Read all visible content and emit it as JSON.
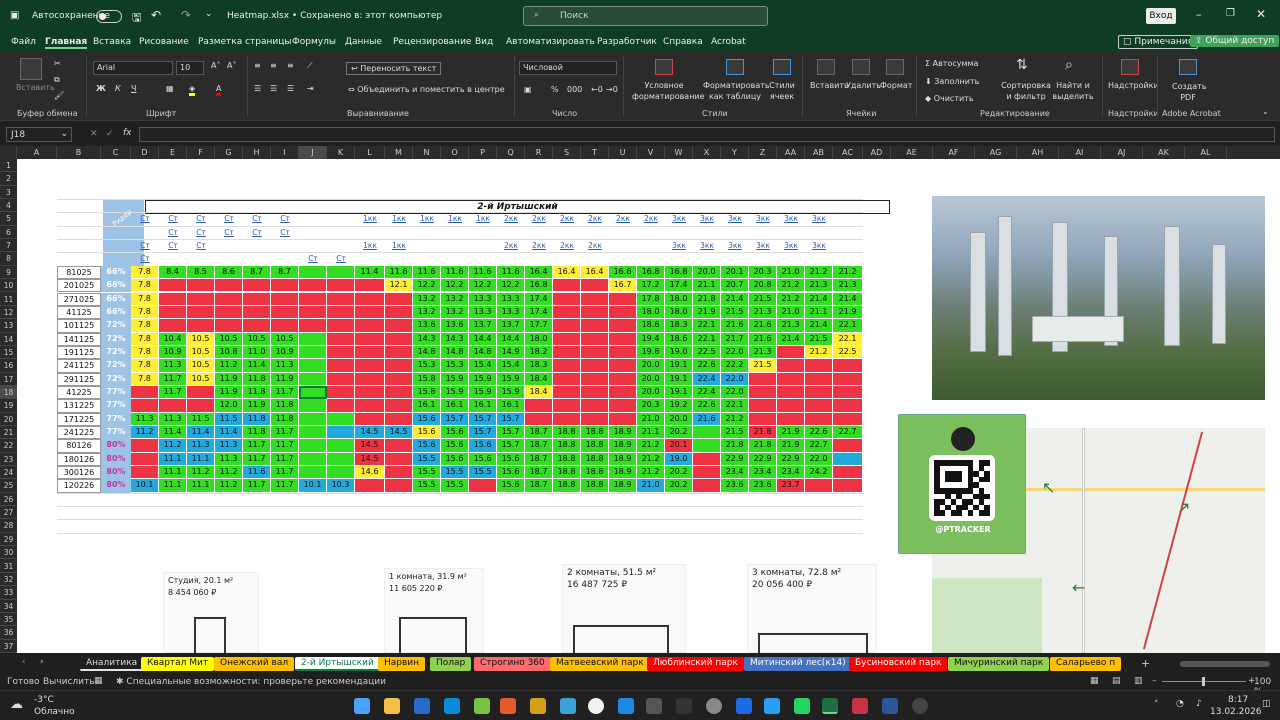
{
  "titlebar": {
    "autosave": "Автосохранение",
    "filename": "Heatmap.xlsx • Сохранено в: этот компьютер",
    "search": "Поиск",
    "signin": "Вход"
  },
  "menu": [
    "Файл",
    "Главная",
    "Вставка",
    "Рисование",
    "Разметка страницы",
    "Формулы",
    "Данные",
    "Рецензирование",
    "Вид",
    "Автоматизировать",
    "Разработчик",
    "Справка",
    "Acrobat"
  ],
  "comments": "Примечания",
  "share": "Общий доступ",
  "ribbon": {
    "paste": "Вставить",
    "clipboard": "Буфер обмена",
    "font_name": "Arial",
    "font_size": "10",
    "font": "Шрифт",
    "wrap": "Переносить текст",
    "merge": "Объединить и поместить в центре",
    "align": "Выравнивание",
    "numfmt": "Числовой",
    "number": "Число",
    "cond": "Условное форматирование",
    "astable": "Форматировать как таблицу",
    "styles_btn": "Стили ячеек",
    "styles": "Стили",
    "insert": "Вставить",
    "delete": "Удалить",
    "format": "Формат",
    "cells": "Ячейки",
    "autosum": "Автосумма",
    "fill": "Заполнить",
    "clear": "Очистить",
    "sort": "Сортировка и фильтр",
    "find": "Найти и выделить",
    "editing": "Редактирование",
    "addins_btn": "Надстройки",
    "addins": "Надстройки",
    "pdf": "Создать PDF",
    "acrobat": "Adobe Acrobat"
  },
  "namebox": "J18",
  "columns": [
    "A",
    "B",
    "C",
    "D",
    "E",
    "F",
    "G",
    "H",
    "I",
    "J",
    "K",
    "L",
    "M",
    "N",
    "O",
    "P",
    "Q",
    "R",
    "S",
    "T",
    "U",
    "V",
    "W",
    "X",
    "Y",
    "Z",
    "AA",
    "AB",
    "AC",
    "AD",
    "AE",
    "AF",
    "AG",
    "AH",
    "AI",
    "AJ",
    "AK",
    "AL"
  ],
  "sheet": {
    "block_title": "2-й Иртышский",
    "r4_header": "Ридер",
    "types": [
      "Ст",
      "Ст",
      "Ст",
      "Ст",
      "Ст",
      "Ст",
      "",
      "",
      "1кк",
      "1кк",
      "1кк",
      "1кк",
      "1кк",
      "2кк",
      "2кк",
      "2кк",
      "2кк",
      "2кк",
      "2кк",
      "3кк",
      "3кк",
      "3кк",
      "3кк",
      "3кк",
      "3кк"
    ],
    "types6": [
      "",
      "Ст",
      "Ст",
      "Ст",
      "Ст",
      "Ст",
      "",
      "",
      "",
      "",
      "",
      "",
      "",
      "",
      "",
      "",
      "",
      "",
      "",
      "",
      "",
      "",
      "",
      "",
      ""
    ],
    "types7": [
      "Ст",
      "Ст",
      "Ст",
      "",
      "",
      "",
      "",
      "",
      "1кк",
      "1кк",
      "",
      "",
      "",
      "2кк",
      "2кк",
      "2кк",
      "2кк",
      "",
      "",
      "3кк",
      "3кк",
      "3кк",
      "3кк",
      "3кк",
      "3кк"
    ],
    "types8": [
      "Ст",
      "",
      "",
      "",
      "",
      "",
      "Ст",
      "Ст",
      "",
      "",
      "",
      "",
      "",
      "",
      "",
      "",
      "",
      "",
      "",
      "",
      "",
      "",
      "",
      "",
      ""
    ],
    "rows": [
      {
        "d": "81025",
        "p": "66%",
        "v": [
          "7.8",
          "8.4",
          "8.5",
          "8.6",
          "8.7",
          "8.7",
          "",
          "",
          "11.4",
          "11.6",
          "11.6",
          "11.6",
          "11.6",
          "11.6",
          "16.4",
          "16.4",
          "16.4",
          "16.6",
          "16.8",
          "16.8",
          "20.0",
          "20.1",
          "20.3",
          "21.0",
          "21.2",
          "21.2"
        ],
        "c": "yggggggggggggggyyggggggggggg"
      },
      {
        "d": "201025",
        "p": "66%",
        "v": [
          "7.8",
          "",
          "",
          "",
          "",
          "",
          "",
          "",
          "",
          "12.1",
          "12.2",
          "12.2",
          "12.2",
          "12.2",
          "16.8",
          "",
          "",
          "16.7",
          "17.2",
          "17.4",
          "21.1",
          "20.7",
          "20.8",
          "21.2",
          "21.3",
          "21.3"
        ],
        "c": "yrrrrrrrrygggggrryggggggg"
      },
      {
        "d": "271025",
        "p": "66%",
        "v": [
          "7.8",
          "",
          "",
          "",
          "",
          "",
          "",
          "",
          "",
          "",
          "13.2",
          "13.2",
          "13.3",
          "13.3",
          "17.4",
          "",
          "",
          "",
          "17.8",
          "18.0",
          "21.8",
          "21.4",
          "21.5",
          "21.2",
          "21.4",
          "21.4"
        ],
        "c": "yrrrrrrrrrgggggrrrggggggg"
      },
      {
        "d": "41125",
        "p": "66%",
        "v": [
          "7.8",
          "",
          "",
          "",
          "",
          "",
          "",
          "",
          "",
          "",
          "13.2",
          "13.2",
          "13.3",
          "13.3",
          "17.4",
          "",
          "",
          "",
          "18.0",
          "18.0",
          "21.9",
          "21.5",
          "21.3",
          "21.0",
          "21.1",
          "21.9"
        ],
        "c": "yrrrrrrrrrgggggrrrggggggg"
      },
      {
        "d": "101125",
        "p": "72%",
        "v": [
          "7.8",
          "",
          "",
          "",
          "",
          "",
          "",
          "",
          "",
          "",
          "13.6",
          "13.6",
          "13.7",
          "13.7",
          "17.7",
          "",
          "",
          "",
          "18.6",
          "18.3",
          "22.1",
          "21.6",
          "21.6",
          "21.3",
          "21.4",
          "22.1"
        ],
        "c": "yrrrrrrrrrgggggrrrggggggg"
      },
      {
        "d": "141125",
        "p": "72%",
        "v": [
          "7.8",
          "10.4",
          "10.5",
          "10.5",
          "10.5",
          "10.5",
          "",
          "",
          "",
          "",
          "14.3",
          "14.3",
          "14.4",
          "14.4",
          "18.0",
          "",
          "",
          "",
          "19.4",
          "18.6",
          "22.1",
          "21.7",
          "21.6",
          "21.4",
          "21.5",
          "22.1"
        ],
        "c": "ygyggggrrrgggggrrrgggggggy"
      },
      {
        "d": "191125",
        "p": "72%",
        "v": [
          "7.8",
          "10.9",
          "10.5",
          "10.8",
          "11.0",
          "10.9",
          "",
          "",
          "",
          "",
          "14.8",
          "14.8",
          "14.8",
          "14.9",
          "18.2",
          "",
          "",
          "",
          "19.8",
          "19.0",
          "22.5",
          "22.0",
          "21.3",
          "",
          "21.2",
          "22.5"
        ],
        "c": "ygyggggrrrgggggrrrgggggryy"
      },
      {
        "d": "241125",
        "p": "72%",
        "v": [
          "7.8",
          "11.3",
          "10.5",
          "11.2",
          "11.4",
          "11.3",
          "",
          "",
          "",
          "",
          "15.3",
          "15.3",
          "15.4",
          "15.4",
          "18.3",
          "",
          "",
          "",
          "20.0",
          "19.1",
          "22.6",
          "22.2",
          "21.5",
          "",
          "",
          ""
        ],
        "c": "ygyggggrrrgggggrrrggggyrrr"
      },
      {
        "d": "291125",
        "p": "72%",
        "v": [
          "7.8",
          "11.7",
          "10.5",
          "11.9",
          "11.8",
          "11.9",
          "",
          "",
          "",
          "",
          "15.8",
          "15.9",
          "15.9",
          "15.9",
          "18.4",
          "",
          "",
          "",
          "20.0",
          "19.1",
          "22.4",
          "22.0",
          "",
          "",
          "",
          ""
        ],
        "c": "ygyggggrrrgggggrrrggbbrrrr"
      },
      {
        "d": "41225",
        "p": "77%",
        "v": [
          "",
          "11.7",
          "",
          "11.9",
          "11.8",
          "11.7",
          "",
          "",
          "",
          "",
          "15.8",
          "15.9",
          "15.9",
          "15.9",
          "18.4",
          "",
          "",
          "",
          "20.0",
          "19.1",
          "22.4",
          "22.0",
          "",
          "",
          "",
          ""
        ],
        "c": "rgrggggrrrggggyrrrggggrrrr"
      },
      {
        "d": "131225",
        "p": "77%",
        "v": [
          "",
          "",
          "",
          "12.0",
          "11.9",
          "11.8",
          "",
          "",
          "",
          "",
          "16.1",
          "16.1",
          "16.1",
          "16.1",
          "",
          "",
          "",
          "",
          "20.3",
          "19.2",
          "22.6",
          "22.1",
          "",
          "",
          "",
          ""
        ],
        "c": "rrrggggrrrggggrrrrggggrrrr"
      },
      {
        "d": "171225",
        "p": "77%",
        "v": [
          "11.3",
          "11.3",
          "11.5",
          "11.5",
          "11.8",
          "11.8",
          "",
          "",
          "",
          "",
          "15.6",
          "15.7",
          "15.7",
          "15.7",
          "",
          "",
          "",
          "",
          "21.0",
          "20.0",
          "21.6",
          "21.2",
          "",
          "",
          "",
          ""
        ],
        "c": "gggbbgggrrbbbbrrrrggbgrrrr"
      },
      {
        "d": "241225",
        "p": "77%",
        "v": [
          "11.2",
          "11.4",
          "11.4",
          "11.4",
          "11.8",
          "11.7",
          "",
          "",
          "14.5",
          "14.5",
          "15.6",
          "15.6",
          "15.7",
          "15.7",
          "18.7",
          "18.8",
          "18.8",
          "18.9",
          "21.1",
          "20.2",
          "",
          "21.5",
          "21.8",
          "21.9",
          "22.6",
          "22.7"
        ],
        "c": "bgbbgggbbbygbgggggggggrggggy"
      },
      {
        "d": "80126",
        "p": "80%",
        "v": [
          "",
          "11.2",
          "11.3",
          "11.3",
          "11.7",
          "11.7",
          "",
          "",
          "14.5",
          "",
          "15.6",
          "15.6",
          "15.6",
          "15.7",
          "18.7",
          "18.8",
          "18.8",
          "18.9",
          "21.2",
          "20.1",
          "",
          "21.8",
          "21.8",
          "21.9",
          "22.7",
          ""
        ],
        "c": "rbbbggggrrbgbggggggrgggggrr"
      },
      {
        "d": "180126",
        "p": "80%",
        "v": [
          "",
          "11.1",
          "11.1",
          "11.3",
          "11.7",
          "11.7",
          "",
          "",
          "14.5",
          "",
          "15.5",
          "15.6",
          "15.6",
          "15.6",
          "18.7",
          "18.8",
          "18.8",
          "18.9",
          "21.2",
          "19.0",
          "",
          "22.9",
          "22.9",
          "22.9",
          "22.0",
          ""
        ],
        "c": "rbbgggggrrbggggggggbrggggbr"
      },
      {
        "d": "300126",
        "p": "80%",
        "v": [
          "",
          "11.1",
          "11.2",
          "11.2",
          "11.6",
          "11.7",
          "",
          "",
          "14.6",
          "",
          "15.5",
          "15.5",
          "15.5",
          "15.6",
          "18.7",
          "18.8",
          "18.8",
          "18.9",
          "21.2",
          "20.2",
          "",
          "23.4",
          "23.4",
          "23.4",
          "24.2",
          ""
        ],
        "c": "rgggbgggyrgbbgggggggrggggr"
      },
      {
        "d": "120226",
        "p": "80%",
        "v": [
          "10.1",
          "11.1",
          "11.1",
          "11.2",
          "11.7",
          "11.7",
          "10.1",
          "10.3",
          "",
          "",
          "15.5",
          "15.5",
          "",
          "15.6",
          "18.7",
          "18.8",
          "18.8",
          "18.9",
          "21.0",
          "20.2",
          "",
          "23.6",
          "23.6",
          "23.7",
          "",
          ""
        ],
        "c": "bgggggbbrrggrgggggbgrggrrr"
      }
    ],
    "plans": [
      {
        "t": "Студия, 20.1 м²",
        "p": "8 454 060 ₽"
      },
      {
        "t": "1 комната, 31.9 м²",
        "p": "11 605 220 ₽"
      },
      {
        "t": "2 комнаты, 51.5 м²",
        "p": "16 487 725 ₽"
      },
      {
        "t": "3 комнаты, 72.8 м²",
        "p": "20 056 400 ₽"
      }
    ],
    "qr_label": "@PTRACKER"
  },
  "tabs": [
    {
      "n": "Аналитика",
      "c": "#e7e6e6"
    },
    {
      "n": "Квартал Мит",
      "c": "#ffff00"
    },
    {
      "n": "Онежский вал",
      "c": "#ffc000"
    },
    {
      "n": "2-й Иртышский",
      "c": "#ffffff"
    },
    {
      "n": "Нарвин",
      "c": "#ffc000"
    },
    {
      "n": "Полар",
      "c": "#92d050"
    },
    {
      "n": "Строгино 360",
      "c": "#ff6b6b"
    },
    {
      "n": "Матвеевский парк",
      "c": "#ffc000"
    },
    {
      "n": "Люблинский парк",
      "c": "#ff0000"
    },
    {
      "n": "Митинский лес(к14)",
      "c": "#4472c4"
    },
    {
      "n": "Бусиновский парк",
      "c": "#ff0000"
    },
    {
      "n": "Мичуринский парк",
      "c": "#92d050"
    },
    {
      "n": "Саларьево п",
      "c": "#ffc000"
    }
  ],
  "status": {
    "ready": "Готово",
    "calc": "Вычислить",
    "access": "Специальные возможности: проверьте рекомендации",
    "zoom": "100 %"
  },
  "taskbar": {
    "temp": "-3°C",
    "weather": "Облачно",
    "time": "8:17",
    "date": "13.02.2026"
  },
  "colors": {
    "green": "#33dd22",
    "red": "#ee3344",
    "yellow": "#ffee33",
    "blue": "#22aadd",
    "header": "#9dc3e6"
  }
}
